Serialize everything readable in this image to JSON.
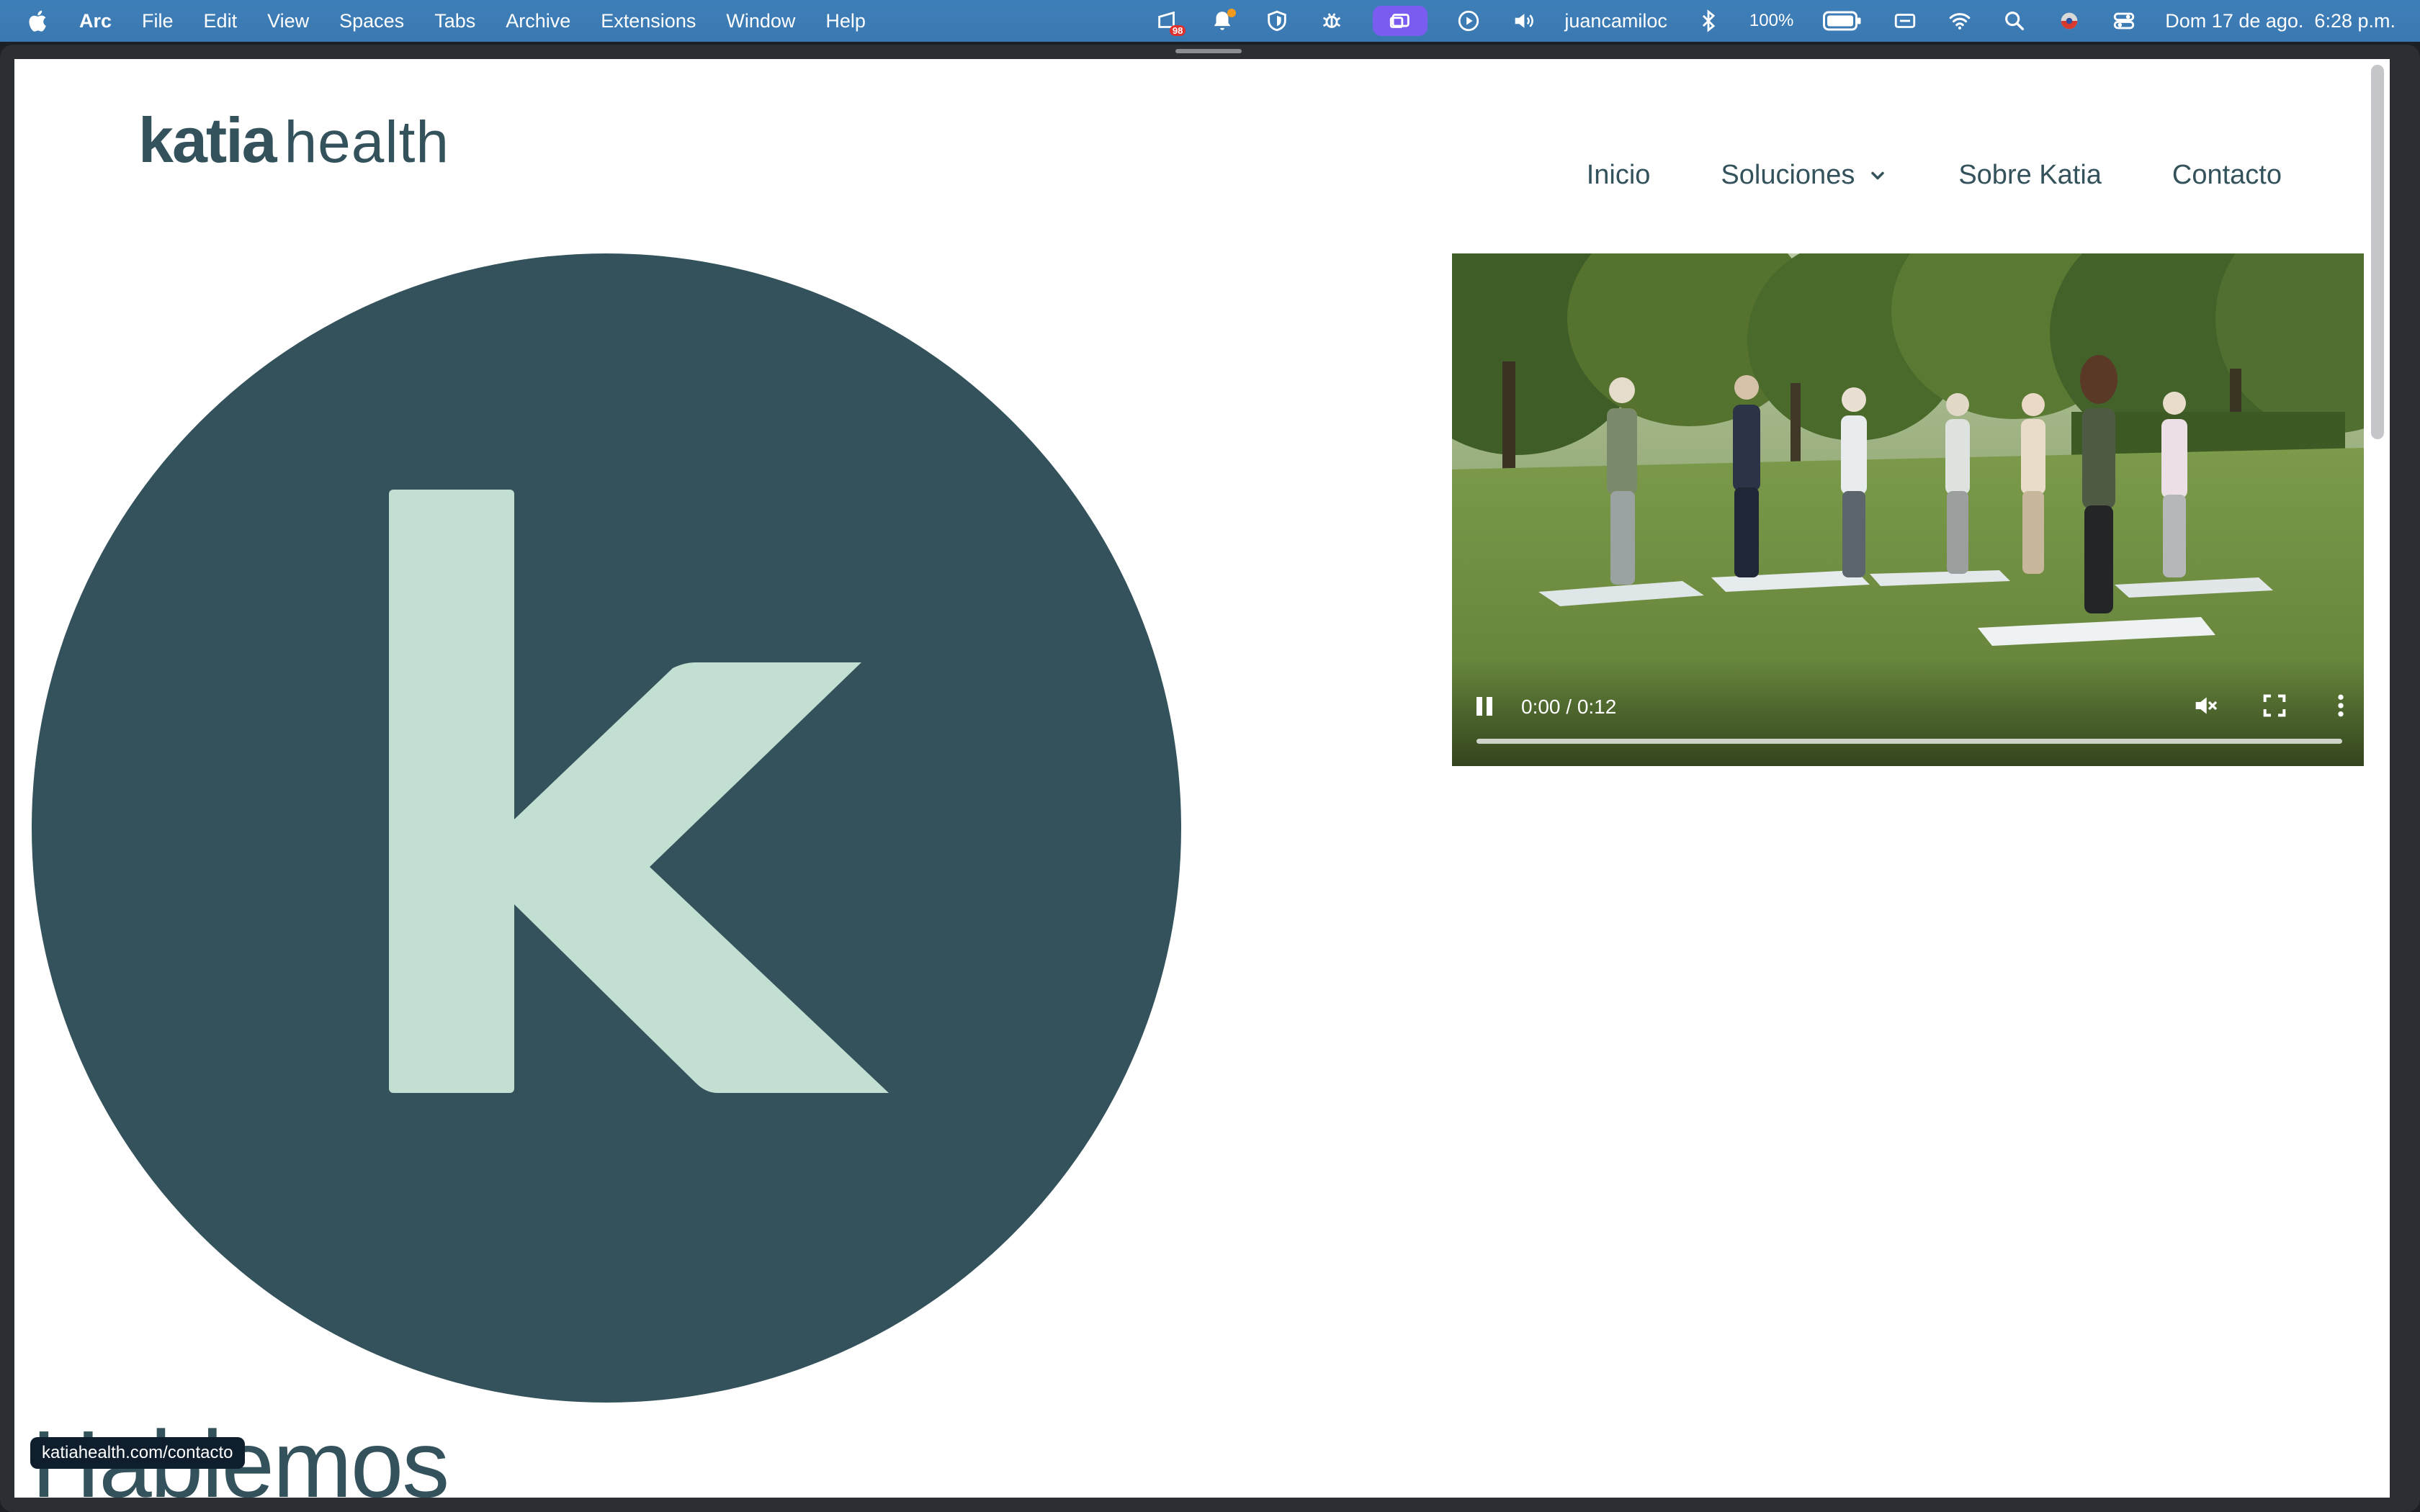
{
  "menubar": {
    "app_name": "Arc",
    "menus": [
      "File",
      "Edit",
      "View",
      "Spaces",
      "Tabs",
      "Archive",
      "Extensions",
      "Window",
      "Help"
    ],
    "badge_count": "98",
    "username": "juancamiloc",
    "battery": "100%",
    "datetime": "Dom 17 de ago.  6:28 p.m."
  },
  "site": {
    "logo": {
      "bold": "katia",
      "light": "health"
    },
    "nav": [
      {
        "label": "Inicio"
      },
      {
        "label": "Soluciones"
      },
      {
        "label": "Sobre Katia"
      },
      {
        "label": "Contacto"
      }
    ],
    "hero_letter": "k",
    "heading": "Hablemos",
    "status_url": "katiahealth.com/contacto"
  },
  "video": {
    "time": "0:00 / 0:12",
    "progress": 0
  },
  "colors": {
    "brand_dark": "#34525b",
    "brand_mint": "#c2dfd2",
    "menubar": "#3c7ab3"
  }
}
